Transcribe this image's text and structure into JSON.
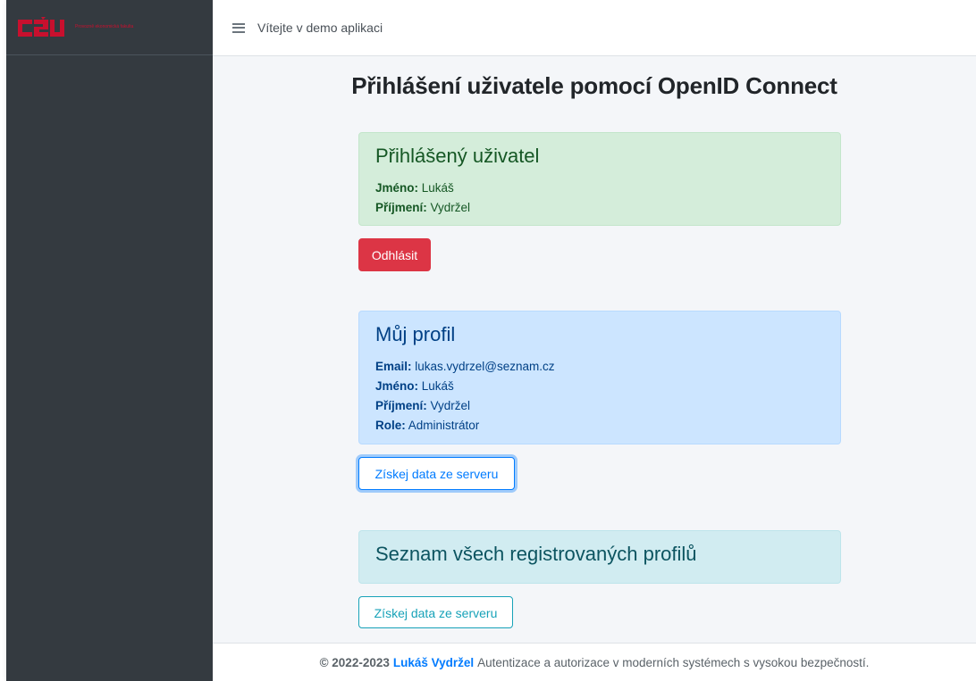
{
  "brand": {
    "logo_text": "Provozně ekonomická fakulta",
    "accent": "#c8102e"
  },
  "topbar": {
    "menu_icon": "hamburger-menu-icon",
    "title": "Vítejte v demo aplikaci"
  },
  "page": {
    "title": "Přihlášení uživatele pomocí OpenID Connect"
  },
  "logged_user": {
    "heading": "Přihlášený uživatel",
    "fields": [
      {
        "label": "Jméno:",
        "value": "Lukáš"
      },
      {
        "label": "Příjmení:",
        "value": "Vydržel"
      }
    ],
    "logout_label": "Odhlásit"
  },
  "profile": {
    "heading": "Můj profil",
    "fields": [
      {
        "label": "Email:",
        "value": "lukas.vydrzel@seznam.cz"
      },
      {
        "label": "Jméno:",
        "value": "Lukáš"
      },
      {
        "label": "Příjmení:",
        "value": "Vydržel"
      },
      {
        "label": "Role:",
        "value": "Administrátor"
      }
    ],
    "fetch_label": "Získej data ze serveru"
  },
  "all_profiles": {
    "heading": "Seznam všech registrovaných profilů",
    "fetch_label": "Získej data ze serveru"
  },
  "footer": {
    "copyright": "© 2022-2023",
    "author": "Lukáš Vydržel",
    "text": "Autentizace a autorizace v moderních systémech s vysokou bezpečností."
  },
  "colors": {
    "sidebar": "#343a40",
    "danger": "#dc3545",
    "primary": "#007bff",
    "info": "#17a2b8",
    "success_bg": "#d4edda",
    "primary_bg": "#cce5ff",
    "info_bg": "#d1ecf1"
  }
}
